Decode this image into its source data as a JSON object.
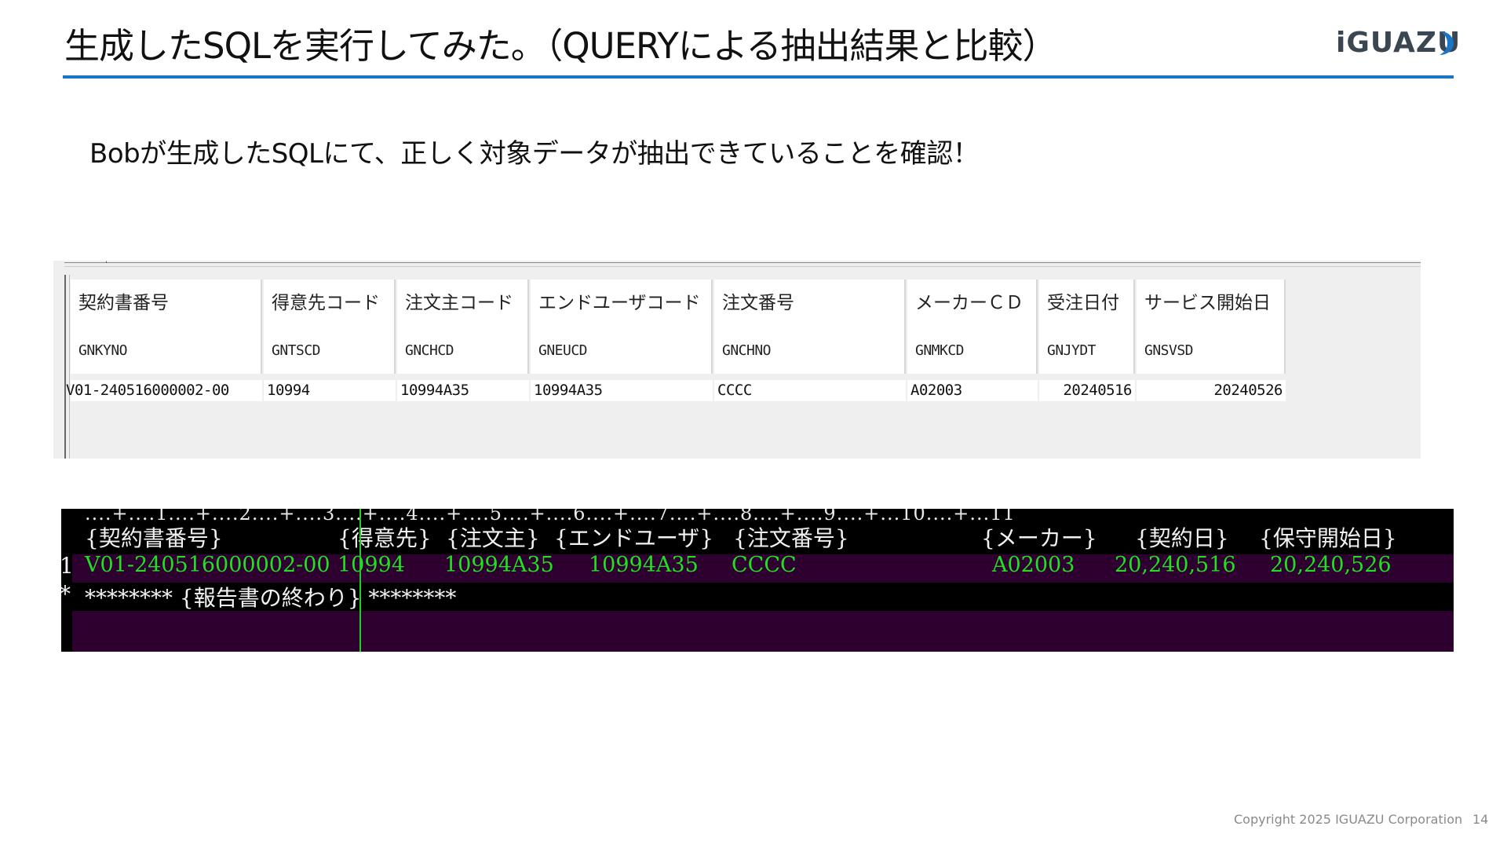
{
  "header": {
    "title": "生成したSQLを実行してみた。（QUERYによる抽出結果と比較）",
    "logo_text": "iGUAZU",
    "accent_color": "#1976c4"
  },
  "lead": "Bobが生成したSQLにて、正しく対象データが抽出できていることを確認！",
  "query_result": {
    "columns": [
      {
        "jp": "契約書番号",
        "field": "GNKYNO",
        "value": "V01-240516000002-00",
        "align": "left"
      },
      {
        "jp": "得意先コード",
        "field": "GNTSCD",
        "value": "10994",
        "align": "left"
      },
      {
        "jp": "注文主コード",
        "field": "GNCHCD",
        "value": "10994A35",
        "align": "left"
      },
      {
        "jp": "エンドユーザコード",
        "field": "GNEUCD",
        "value": "10994A35",
        "align": "left"
      },
      {
        "jp": "注文番号",
        "field": "GNCHNO",
        "value": "CCCC",
        "align": "left"
      },
      {
        "jp": "メーカーＣＤ",
        "field": "GNMKCD",
        "value": "A02003",
        "align": "left"
      },
      {
        "jp": "受注日付",
        "field": "GNJYDT",
        "value": "20240516",
        "align": "right"
      },
      {
        "jp": "サービス開始日",
        "field": "GNSVSD",
        "value": "20240526",
        "align": "right"
      }
    ]
  },
  "terminal": {
    "ruler": "....+....1....+....2....+....3....+....4....+....5....+....6....+....7....+....8....+....9....+...10....+...11",
    "headers": [
      "{契約書番号}",
      "{得意先}",
      "{注文主}",
      "{エンドユーザ}",
      "{注文番号}",
      "{メーカー}",
      "{契約日}",
      "{保守開始日}"
    ],
    "row_number": "1",
    "row_values": [
      "V01-240516000002-00",
      "10994",
      "10994A35",
      "10994A35",
      "CCCC",
      "A02003",
      "20,240,516",
      "20,240,526"
    ],
    "end_marker": "*",
    "end_text": "******** {報告書の終わり} ********",
    "text_color": "#20e020",
    "row_bg": "#2e0030"
  },
  "footer": {
    "copyright": "Copyright 2025 IGUAZU Corporation",
    "page": "14"
  }
}
